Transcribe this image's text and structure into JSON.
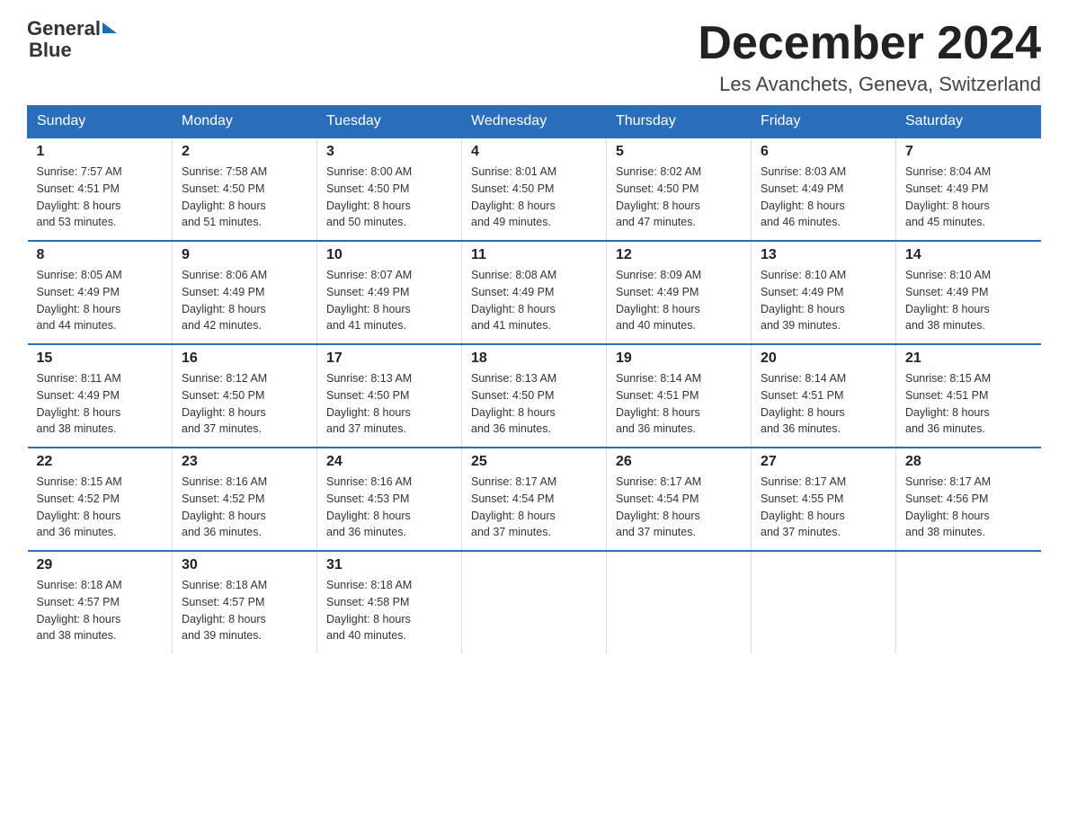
{
  "header": {
    "logo_text_general": "General",
    "logo_text_blue": "Blue",
    "month_title": "December 2024",
    "location": "Les Avanchets, Geneva, Switzerland"
  },
  "days_of_week": [
    "Sunday",
    "Monday",
    "Tuesday",
    "Wednesday",
    "Thursday",
    "Friday",
    "Saturday"
  ],
  "weeks": [
    [
      {
        "day": "1",
        "sunrise": "7:57 AM",
        "sunset": "4:51 PM",
        "daylight": "8 hours and 53 minutes."
      },
      {
        "day": "2",
        "sunrise": "7:58 AM",
        "sunset": "4:50 PM",
        "daylight": "8 hours and 51 minutes."
      },
      {
        "day": "3",
        "sunrise": "8:00 AM",
        "sunset": "4:50 PM",
        "daylight": "8 hours and 50 minutes."
      },
      {
        "day": "4",
        "sunrise": "8:01 AM",
        "sunset": "4:50 PM",
        "daylight": "8 hours and 49 minutes."
      },
      {
        "day": "5",
        "sunrise": "8:02 AM",
        "sunset": "4:50 PM",
        "daylight": "8 hours and 47 minutes."
      },
      {
        "day": "6",
        "sunrise": "8:03 AM",
        "sunset": "4:49 PM",
        "daylight": "8 hours and 46 minutes."
      },
      {
        "day": "7",
        "sunrise": "8:04 AM",
        "sunset": "4:49 PM",
        "daylight": "8 hours and 45 minutes."
      }
    ],
    [
      {
        "day": "8",
        "sunrise": "8:05 AM",
        "sunset": "4:49 PM",
        "daylight": "8 hours and 44 minutes."
      },
      {
        "day": "9",
        "sunrise": "8:06 AM",
        "sunset": "4:49 PM",
        "daylight": "8 hours and 42 minutes."
      },
      {
        "day": "10",
        "sunrise": "8:07 AM",
        "sunset": "4:49 PM",
        "daylight": "8 hours and 41 minutes."
      },
      {
        "day": "11",
        "sunrise": "8:08 AM",
        "sunset": "4:49 PM",
        "daylight": "8 hours and 41 minutes."
      },
      {
        "day": "12",
        "sunrise": "8:09 AM",
        "sunset": "4:49 PM",
        "daylight": "8 hours and 40 minutes."
      },
      {
        "day": "13",
        "sunrise": "8:10 AM",
        "sunset": "4:49 PM",
        "daylight": "8 hours and 39 minutes."
      },
      {
        "day": "14",
        "sunrise": "8:10 AM",
        "sunset": "4:49 PM",
        "daylight": "8 hours and 38 minutes."
      }
    ],
    [
      {
        "day": "15",
        "sunrise": "8:11 AM",
        "sunset": "4:49 PM",
        "daylight": "8 hours and 38 minutes."
      },
      {
        "day": "16",
        "sunrise": "8:12 AM",
        "sunset": "4:50 PM",
        "daylight": "8 hours and 37 minutes."
      },
      {
        "day": "17",
        "sunrise": "8:13 AM",
        "sunset": "4:50 PM",
        "daylight": "8 hours and 37 minutes."
      },
      {
        "day": "18",
        "sunrise": "8:13 AM",
        "sunset": "4:50 PM",
        "daylight": "8 hours and 36 minutes."
      },
      {
        "day": "19",
        "sunrise": "8:14 AM",
        "sunset": "4:51 PM",
        "daylight": "8 hours and 36 minutes."
      },
      {
        "day": "20",
        "sunrise": "8:14 AM",
        "sunset": "4:51 PM",
        "daylight": "8 hours and 36 minutes."
      },
      {
        "day": "21",
        "sunrise": "8:15 AM",
        "sunset": "4:51 PM",
        "daylight": "8 hours and 36 minutes."
      }
    ],
    [
      {
        "day": "22",
        "sunrise": "8:15 AM",
        "sunset": "4:52 PM",
        "daylight": "8 hours and 36 minutes."
      },
      {
        "day": "23",
        "sunrise": "8:16 AM",
        "sunset": "4:52 PM",
        "daylight": "8 hours and 36 minutes."
      },
      {
        "day": "24",
        "sunrise": "8:16 AM",
        "sunset": "4:53 PM",
        "daylight": "8 hours and 36 minutes."
      },
      {
        "day": "25",
        "sunrise": "8:17 AM",
        "sunset": "4:54 PM",
        "daylight": "8 hours and 37 minutes."
      },
      {
        "day": "26",
        "sunrise": "8:17 AM",
        "sunset": "4:54 PM",
        "daylight": "8 hours and 37 minutes."
      },
      {
        "day": "27",
        "sunrise": "8:17 AM",
        "sunset": "4:55 PM",
        "daylight": "8 hours and 37 minutes."
      },
      {
        "day": "28",
        "sunrise": "8:17 AM",
        "sunset": "4:56 PM",
        "daylight": "8 hours and 38 minutes."
      }
    ],
    [
      {
        "day": "29",
        "sunrise": "8:18 AM",
        "sunset": "4:57 PM",
        "daylight": "8 hours and 38 minutes."
      },
      {
        "day": "30",
        "sunrise": "8:18 AM",
        "sunset": "4:57 PM",
        "daylight": "8 hours and 39 minutes."
      },
      {
        "day": "31",
        "sunrise": "8:18 AM",
        "sunset": "4:58 PM",
        "daylight": "8 hours and 40 minutes."
      },
      null,
      null,
      null,
      null
    ]
  ],
  "labels": {
    "sunrise": "Sunrise:",
    "sunset": "Sunset:",
    "daylight": "Daylight:"
  }
}
